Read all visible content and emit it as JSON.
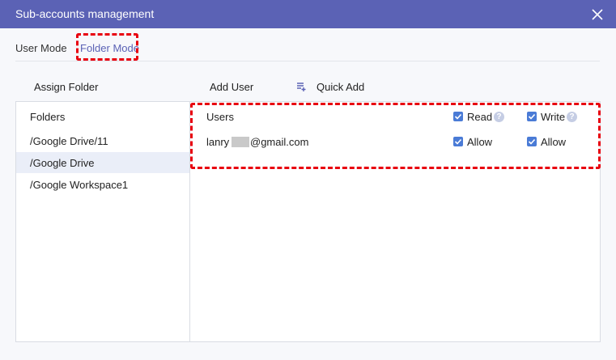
{
  "window": {
    "title": "Sub-accounts management"
  },
  "tabs": [
    {
      "label": "User Mode",
      "active": false
    },
    {
      "label": "Folder Mode",
      "active": true
    }
  ],
  "toolbar": {
    "assign_folder": "Assign Folder",
    "add_user": "Add User",
    "quick_add": "Quick Add"
  },
  "folders": {
    "header": "Folders",
    "items": [
      "/Google Drive/11",
      "/Google Drive",
      "/Google Workspace1"
    ],
    "selected_index": 1
  },
  "users_table": {
    "header_users": "Users",
    "header_read": "Read",
    "header_write": "Write",
    "help_glyph": "?",
    "rows": [
      {
        "email_prefix": "lanry",
        "email_suffix": "@gmail.com",
        "read": "Allow",
        "write": "Allow"
      }
    ]
  },
  "colors": {
    "accent": "#5b62b5",
    "checkbox": "#4a7bd6",
    "highlight": "#e8000f"
  }
}
